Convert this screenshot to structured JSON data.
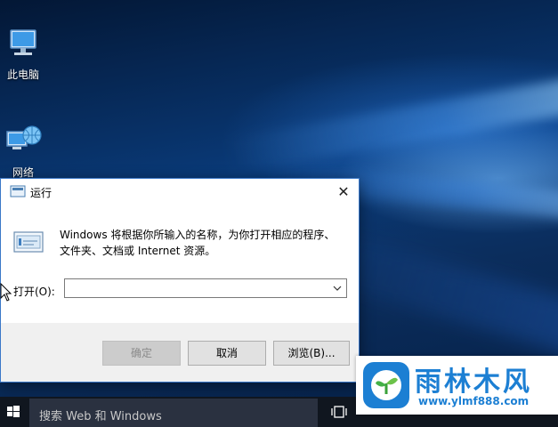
{
  "desktop": {
    "icons": [
      {
        "label": "此电脑",
        "icon": "computer-icon"
      },
      {
        "label": "网络",
        "icon": "network-icon"
      }
    ]
  },
  "run_dialog": {
    "title": "运行",
    "close": "✕",
    "description": "Windows 将根据你所输入的名称，为你打开相应的程序、文件夹、文档或 Internet 资源。",
    "open_label": "打开(O):",
    "open_value": "",
    "buttons": {
      "ok": "确定",
      "cancel": "取消",
      "browse": "浏览(B)..."
    }
  },
  "taskbar": {
    "search_placeholder": "搜索 Web 和 Windows"
  },
  "watermark": {
    "title": "雨林木风",
    "url": "www.ylmf888.com"
  },
  "colors": {
    "accent": "#1c7fd3",
    "dialog_border": "#3b78c8",
    "taskbar": "#10161f"
  }
}
